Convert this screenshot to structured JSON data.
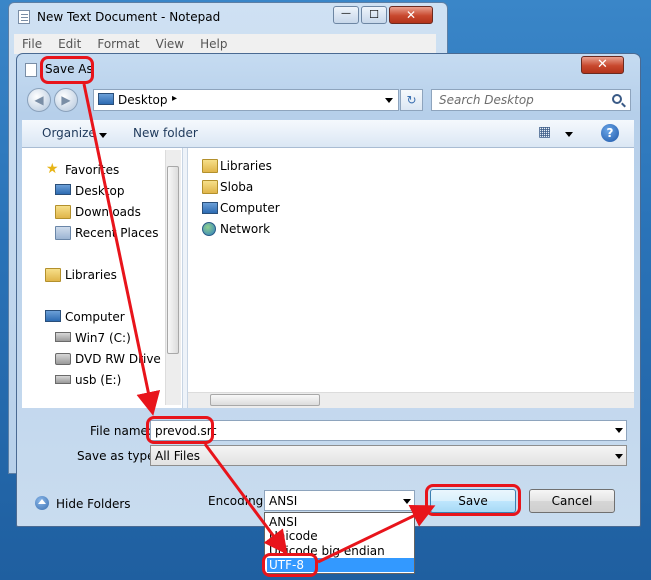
{
  "notepad": {
    "title": "New Text Document - Notepad",
    "menu": [
      "File",
      "Edit",
      "Format",
      "View",
      "Help"
    ],
    "controls": {
      "minimize": "—",
      "maximize": "☐",
      "close": "✕"
    }
  },
  "dialog": {
    "title": "Save As",
    "close_label": "✕",
    "address": {
      "path": "Desktop",
      "chevron": "▸",
      "refresh": "↻"
    },
    "search": {
      "placeholder": "Search Desktop"
    },
    "toolbar": {
      "organize": "Organize",
      "new_folder": "New folder",
      "view_icon": "▦",
      "help": "?"
    },
    "nav_pane": {
      "favorites": {
        "label": "Favorites",
        "items": [
          "Desktop",
          "Downloads",
          "Recent Places"
        ]
      },
      "libraries": "Libraries",
      "computer": {
        "label": "Computer",
        "items": [
          "Win7 (C:)",
          "DVD RW Drive (D",
          "usb (E:)"
        ]
      }
    },
    "content_items": [
      "Libraries",
      "Sloba",
      "Computer",
      "Network"
    ],
    "file_name": {
      "label": "File name:",
      "value": "prevod.srt"
    },
    "save_as_type": {
      "label": "Save as type:",
      "value": "All Files"
    },
    "hide_folders": "Hide Folders",
    "encoding": {
      "label": "Encoding:",
      "selected": "ANSI",
      "options": [
        "ANSI",
        "Unicode",
        "Unicode big endian",
        "UTF-8"
      ],
      "highlighted": "UTF-8"
    },
    "buttons": {
      "save": "Save",
      "cancel": "Cancel"
    }
  },
  "annotations": {
    "color": "#e8141b"
  }
}
